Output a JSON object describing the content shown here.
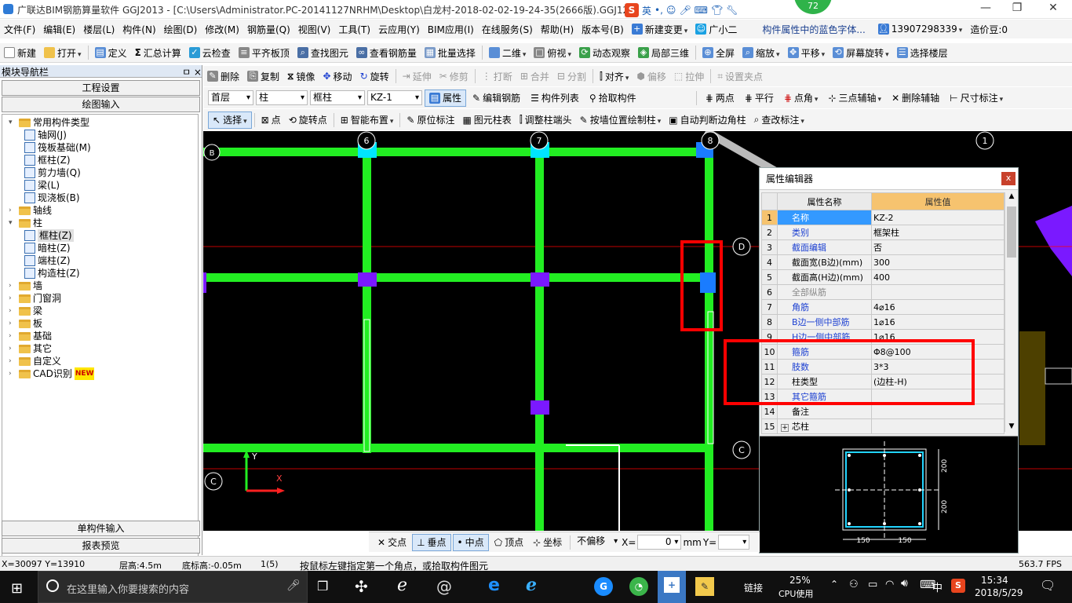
{
  "window": {
    "title": "广联达BIM钢筋算量软件 GGJ2013 - [C:\\Users\\Administrator.PC-20141127NRHM\\Desktop\\白龙村-2018-02-02-19-24-35(2666版).GGJ12]",
    "ime_label": "英",
    "score_badge": "72",
    "minimize": "—",
    "maximize": "❐",
    "close": "✕"
  },
  "menubar": {
    "items": [
      "文件(F)",
      "编辑(E)",
      "楼层(L)",
      "构件(N)",
      "绘图(D)",
      "修改(M)",
      "钢筋量(Q)",
      "视图(V)",
      "工具(T)",
      "云应用(Y)",
      "BIM应用(I)",
      "在线服务(S)",
      "帮助(H)",
      "版本号(B)"
    ],
    "new_change": "新建变更",
    "assistant": "广小二",
    "hint": "构件属性中的蓝色字体...",
    "phone": "13907298339",
    "price_bean": "造价豆:0"
  },
  "toolbar1": [
    "新建",
    "打开",
    "定义",
    "汇总计算",
    "云检查",
    "平齐板顶",
    "查找图元",
    "查看钢筋量",
    "批量选择",
    "二维",
    "俯视",
    "动态观察",
    "局部三维",
    "全屏",
    "缩放",
    "平移",
    "屏幕旋转",
    "选择楼层"
  ],
  "toolbar2": [
    "删除",
    "复制",
    "镜像",
    "移动",
    "旋转",
    "延伸",
    "修剪",
    "打断",
    "合并",
    "分割",
    "对齐",
    "偏移",
    "拉伸",
    "设置夹点"
  ],
  "toolbar3": {
    "floor": "首层",
    "category": "柱",
    "type": "框柱",
    "component": "KZ-1",
    "buttons": [
      "属性",
      "编辑钢筋",
      "构件列表",
      "拾取构件"
    ],
    "right": [
      "两点",
      "平行",
      "点角",
      "三点辅轴",
      "删除辅轴",
      "尺寸标注"
    ]
  },
  "toolbar4": [
    "选择",
    "点",
    "旋转点",
    "智能布置",
    "原位标注",
    "图元柱表",
    "调整柱端头",
    "按墙位置绘制柱",
    "自动判断边角柱",
    "查改标注"
  ],
  "nav": {
    "header": "模块导航栏",
    "pin": "ㅁ ×",
    "btn_project": "工程设置",
    "btn_draw": "绘图输入",
    "btn_single": "单构件输入",
    "btn_report": "报表预览",
    "tree": [
      {
        "label": "常用构件类型",
        "level": 0,
        "folder": true,
        "expanded": true
      },
      {
        "label": "轴网(J)",
        "level": 1
      },
      {
        "label": "筏板基础(M)",
        "level": 1
      },
      {
        "label": "框柱(Z)",
        "level": 1
      },
      {
        "label": "剪力墙(Q)",
        "level": 1
      },
      {
        "label": "梁(L)",
        "level": 1
      },
      {
        "label": "现浇板(B)",
        "level": 1
      },
      {
        "label": "轴线",
        "level": 0,
        "folder": true
      },
      {
        "label": "柱",
        "level": 0,
        "folder": true,
        "expanded": true
      },
      {
        "label": "框柱(Z)",
        "level": 1,
        "selected": true
      },
      {
        "label": "暗柱(Z)",
        "level": 1
      },
      {
        "label": "端柱(Z)",
        "level": 1
      },
      {
        "label": "构造柱(Z)",
        "level": 1
      },
      {
        "label": "墙",
        "level": 0,
        "folder": true
      },
      {
        "label": "门窗洞",
        "level": 0,
        "folder": true
      },
      {
        "label": "梁",
        "level": 0,
        "folder": true
      },
      {
        "label": "板",
        "level": 0,
        "folder": true
      },
      {
        "label": "基础",
        "level": 0,
        "folder": true
      },
      {
        "label": "其它",
        "level": 0,
        "folder": true
      },
      {
        "label": "自定义",
        "level": 0,
        "folder": true
      },
      {
        "label": "CAD识别",
        "level": 0,
        "folder": true,
        "badge": "NEW"
      }
    ]
  },
  "canvas": {
    "axis_labels": [
      "6",
      "7",
      "8",
      "1",
      "D",
      "C",
      "C",
      "B"
    ],
    "axis_x": "X",
    "axis_y": "Y"
  },
  "prop_editor": {
    "title": "属性编辑器",
    "close": "x",
    "col_name": "属性名称",
    "col_value": "属性值",
    "rows": [
      {
        "n": "1",
        "name": "名称",
        "value": "KZ-2",
        "style": "blue",
        "selected": true
      },
      {
        "n": "2",
        "name": "类别",
        "value": "框架柱",
        "style": "blue"
      },
      {
        "n": "3",
        "name": "截面编辑",
        "value": "否",
        "style": "blue"
      },
      {
        "n": "4",
        "name": "截面宽(B边)(mm)",
        "value": "300",
        "style": "black"
      },
      {
        "n": "5",
        "name": "截面高(H边)(mm)",
        "value": "400",
        "style": "black"
      },
      {
        "n": "6",
        "name": "全部纵筋",
        "value": "",
        "style": "gray"
      },
      {
        "n": "7",
        "name": "角筋",
        "value": "4⌀16",
        "style": "blue"
      },
      {
        "n": "8",
        "name": "B边一侧中部筋",
        "value": "1⌀16",
        "style": "blue"
      },
      {
        "n": "9",
        "name": "H边一侧中部筋",
        "value": "1⌀16",
        "style": "blue"
      },
      {
        "n": "10",
        "name": "箍筋",
        "value": "Φ8@100",
        "style": "blue"
      },
      {
        "n": "11",
        "name": "肢数",
        "value": "3*3",
        "style": "blue"
      },
      {
        "n": "12",
        "name": "柱类型",
        "value": "(边柱-H)",
        "style": "black"
      },
      {
        "n": "13",
        "name": "其它箍筋",
        "value": "",
        "style": "blue"
      },
      {
        "n": "14",
        "name": "备注",
        "value": "",
        "style": "black"
      },
      {
        "n": "15",
        "name": "芯柱",
        "value": "",
        "style": "black",
        "expandable": true
      }
    ],
    "section": {
      "dim_b1": "150",
      "dim_b2": "150",
      "dim_h1": "200",
      "dim_h2": "200"
    }
  },
  "snapbar": {
    "items": [
      "交点",
      "垂点",
      "中点",
      "顶点",
      "坐标"
    ],
    "offset_mode": "不偏移",
    "x_label": "X=",
    "x_value": "0",
    "unit": "mm",
    "y_label": "Y="
  },
  "statusbar": {
    "coords": "X=30097 Y=13910",
    "floor_height": "层高:4.5m",
    "bottom_elev": "底标高:-0.05m",
    "count": "1(5)",
    "hint": "按鼠标左键指定第一个角点，或拾取构件图元",
    "fps": "563.7 FPS"
  },
  "taskbar": {
    "search_placeholder": "在这里输入你要搜索的内容",
    "link": "链接",
    "cpu_percent": "25%",
    "cpu_label": "CPU使用",
    "lang": "中",
    "time": "15:34",
    "date": "2018/5/29"
  },
  "colors": {
    "beam": "#22ee22",
    "column": "#7a19ff",
    "column_selected": "#1a7cff",
    "highlight": "#ff0000",
    "canvas_bg": "#000000"
  }
}
